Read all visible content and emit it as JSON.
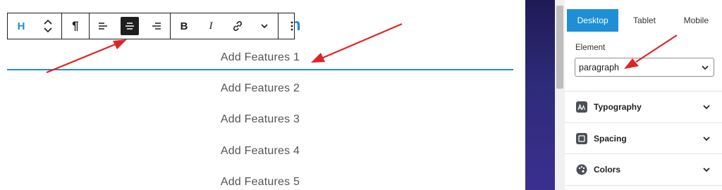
{
  "editor": {
    "heading_peek": "h",
    "toolbar": {
      "heading_label": "H",
      "bold_label": "B",
      "italic_label": "I",
      "paragraph_symbol": "¶"
    },
    "features": [
      "Add Features 1",
      "Add Features 2",
      "Add Features 3",
      "Add Features 4",
      "Add Features 5"
    ]
  },
  "panel": {
    "device_tabs": [
      {
        "label": "Desktop",
        "active": true
      },
      {
        "label": "Tablet",
        "active": false
      },
      {
        "label": "Mobile",
        "active": false
      }
    ],
    "element_label": "Element",
    "element_select": "paragraph",
    "sections": [
      {
        "label": "Typography",
        "icon": "typography-icon"
      },
      {
        "label": "Spacing",
        "icon": "spacing-icon"
      },
      {
        "label": "Colors",
        "icon": "palette-icon"
      }
    ]
  },
  "colors": {
    "accent": "#1e8fd6",
    "annotation_arrow": "#e02424",
    "toolbar_border": "#1e1e1e"
  }
}
